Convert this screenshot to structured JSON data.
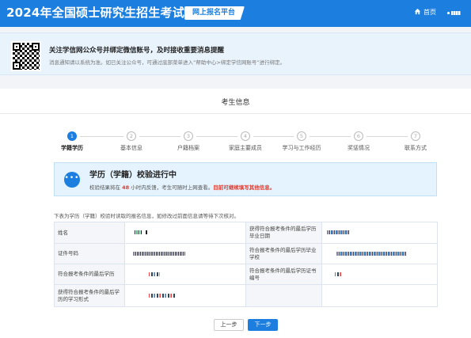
{
  "header": {
    "site_title": "2024年全国硕士研究生招生考试",
    "platform_tag": "网上报名平台",
    "home_label": "首页"
  },
  "notice": {
    "title": "关注学信网公众号并绑定微信账号，及时接收重要消息提醒",
    "description": "消息通知请以系统为准。如已关注公众号，可通过底部菜单进入“帮助中心>绑定学信网账号”进行绑定。"
  },
  "card": {
    "title": "考生信息"
  },
  "steps": [
    {
      "num": "1",
      "label": "学籍学历",
      "active": true
    },
    {
      "num": "2",
      "label": "基本信息",
      "active": false
    },
    {
      "num": "3",
      "label": "户籍档案",
      "active": false
    },
    {
      "num": "4",
      "label": "家庭主要成员",
      "active": false
    },
    {
      "num": "5",
      "label": "学习与工作经历",
      "active": false
    },
    {
      "num": "6",
      "label": "奖惩情况",
      "active": false
    },
    {
      "num": "7",
      "label": "联系方式",
      "active": false
    }
  ],
  "verify": {
    "icon_text": "•••",
    "title": "学历（学籍）校验进行中",
    "sub_before": "校验结果将在",
    "hours": "48",
    "sub_middle": "小时内反馈，考生可随时上网查看。",
    "sub_highlight": "目前可继续填写其他信息。"
  },
  "info_note": "下表为学历（学籍）校验时读取的报名信息，如修改过前面信息请等待下次核对。",
  "table": {
    "rows": [
      {
        "l1": "姓名",
        "l2": "获得符合报考条件的最后学历毕业日期"
      },
      {
        "l1": "证件号码",
        "l2": "符合报考条件的最后学历毕业学校"
      },
      {
        "l1": "符合报考条件的最后学历",
        "l2": "符合报考条件的最后学历证书编号"
      },
      {
        "l1": "获得符合报考条件的最后学历的学习形式",
        "l2": ""
      }
    ]
  },
  "buttons": {
    "prev": "上一步",
    "next": "下一步"
  },
  "colors": {
    "primary": "#1c7fe0",
    "highlight_red": "#e23a2e",
    "notice_bg": "#e9f3fc"
  }
}
